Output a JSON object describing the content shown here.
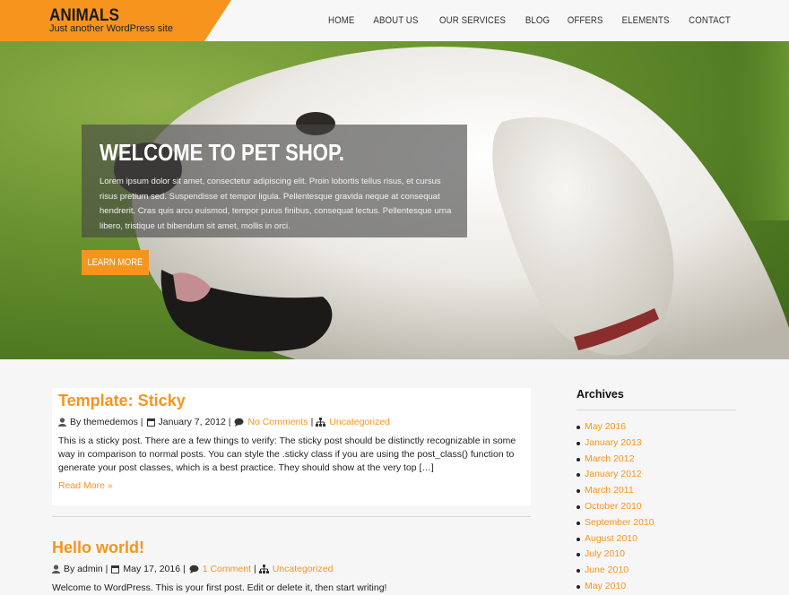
{
  "site": {
    "title": "ANIMALS",
    "tagline": "Just another WordPress site"
  },
  "nav": [
    "HOME",
    "ABOUT US",
    "OUR SERVICES",
    "BLOG",
    "OFFERS",
    "ELEMENTS",
    "CONTACT"
  ],
  "hero": {
    "title": "WELCOME TO PET SHOP.",
    "text": "Lorem ipsum dolor sit amet, consectetur adipiscing elit. Proin lobortis tellus risus, et cursus risus pretium sed. Suspendisse et tempor ligula. Pellentesque gravida neque at consequat hendrerit. Cras quis arcu euismod, tempor purus finibus, consequat lectus. Pellentesque urna libero, tristique ut bibendum sit amet, mollis in orci.",
    "button": "LEARN MORE"
  },
  "posts": [
    {
      "title": "Template: Sticky",
      "by": "By themedemos |",
      "date": "January 7, 2012 |",
      "comments": "No Comments",
      "sep": "|",
      "category": "Uncategorized",
      "body": "This is a sticky post. There are a few things to verify: The sticky post should be distinctly recognizable in some way in comparison to normal posts. You can style the .sticky class if you are using the post_class() function to generate your post classes, which is a best practice. They should show at the very top […]",
      "read_more": "Read More »"
    },
    {
      "title": "Hello world!",
      "by": "By admin |",
      "date": "May 17, 2016 |",
      "comments": "1 Comment",
      "sep": "|",
      "category": "Uncategorized",
      "body": "Welcome to WordPress. This is your first post. Edit or delete it, then start writing!"
    }
  ],
  "sidebar": {
    "title": "Archives",
    "items": [
      "May 2016",
      "January 2013",
      "March 2012",
      "January 2012",
      "March 2011",
      "October 2010",
      "September 2010",
      "August 2010",
      "July 2010",
      "June 2010",
      "May 2010"
    ]
  },
  "colors": {
    "accent": "#f7941d"
  }
}
